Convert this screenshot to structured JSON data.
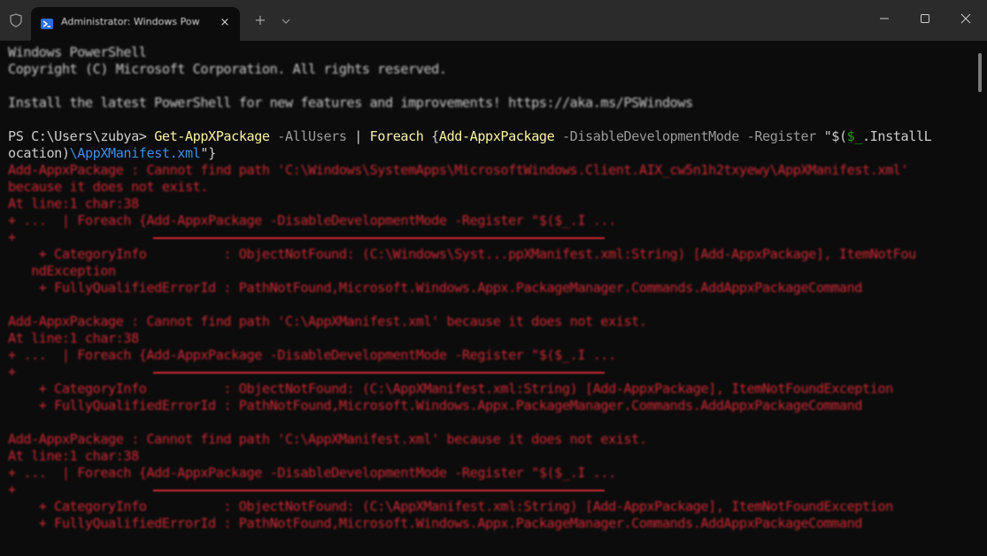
{
  "window": {
    "tab_title": "Administrator: Windows Pow",
    "tab_close": "×",
    "new_tab": "+",
    "tab_dropdown": "⌄"
  },
  "colors": {
    "background": "#0c0c0c",
    "titlebar": "#2b2b2b",
    "text": "#cccccc",
    "command": "#f9f1a5",
    "parameter": "#9a9a9a",
    "path_string": "#3b8eea",
    "variable": "#13a10e",
    "error": "#d02a35"
  },
  "terminal": {
    "header": {
      "line1": "Windows PowerShell",
      "line2": "Copyright (C) Microsoft Corporation. All rights reserved.",
      "line3": "Install the latest PowerShell for new features and improvements! https://aka.ms/PSWindows"
    },
    "command": {
      "prompt": "PS C:\\Users\\zubya> ",
      "cmd1": "Get-AppXPackage",
      "param1": " -AllUsers",
      "pipe": " | ",
      "cmd2": "Foreach",
      "brace_open": " {",
      "cmd3": "Add-AppxPackage",
      "param2": " -DisableDevelopmentMode",
      "param3": " -Register",
      "str_open": " \"$(",
      "var": "$_",
      "member1": ".InstallL",
      "member2": "ocation)",
      "path": "\\AppXManifest.xml",
      "str_close": "\"",
      "brace_close": "}"
    },
    "errors": [
      {
        "msg1": "Add-AppxPackage : Cannot find path 'C:\\Windows\\SystemApps\\MicrosoftWindows.Client.AIX_cw5n1h2txyewy\\AppXManifest.xml'",
        "msg2": "because it does not exist.",
        "at": "At line:1 char:38",
        "snippet": "+ ...  | Foreach {Add-AppxPackage -DisableDevelopmentMode -Register \"$($_.I ...",
        "plus": "+",
        "category1": "    + CategoryInfo          : ObjectNotFound: (C:\\Windows\\Syst...ppXManifest.xml:String) [Add-AppxPackage], ItemNotFou",
        "category2": "   ndException",
        "fqid": "    + FullyQualifiedErrorId : PathNotFound,Microsoft.Windows.Appx.PackageManager.Commands.AddAppxPackageCommand"
      },
      {
        "msg1": "Add-AppxPackage : Cannot find path 'C:\\AppXManifest.xml' because it does not exist.",
        "at": "At line:1 char:38",
        "snippet": "+ ...  | Foreach {Add-AppxPackage -DisableDevelopmentMode -Register \"$($_.I ...",
        "plus": "+",
        "category1": "    + CategoryInfo          : ObjectNotFound: (C:\\AppXManifest.xml:String) [Add-AppxPackage], ItemNotFoundException",
        "fqid": "    + FullyQualifiedErrorId : PathNotFound,Microsoft.Windows.Appx.PackageManager.Commands.AddAppxPackageCommand"
      },
      {
        "msg1": "Add-AppxPackage : Cannot find path 'C:\\AppXManifest.xml' because it does not exist.",
        "at": "At line:1 char:38",
        "snippet": "+ ...  | Foreach {Add-AppxPackage -DisableDevelopmentMode -Register \"$($_.I ...",
        "plus": "+",
        "category1": "    + CategoryInfo          : ObjectNotFound: (C:\\AppXManifest.xml:String) [Add-AppxPackage], ItemNotFoundException",
        "fqid": "    + FullyQualifiedErrorId : PathNotFound,Microsoft.Windows.Appx.PackageManager.Commands.AddAppxPackageCommand"
      }
    ]
  },
  "icons": {
    "app": "shield-icon",
    "tab": "powershell-icon",
    "minimize": "minimize-icon",
    "maximize": "maximize-icon",
    "close": "close-icon"
  }
}
